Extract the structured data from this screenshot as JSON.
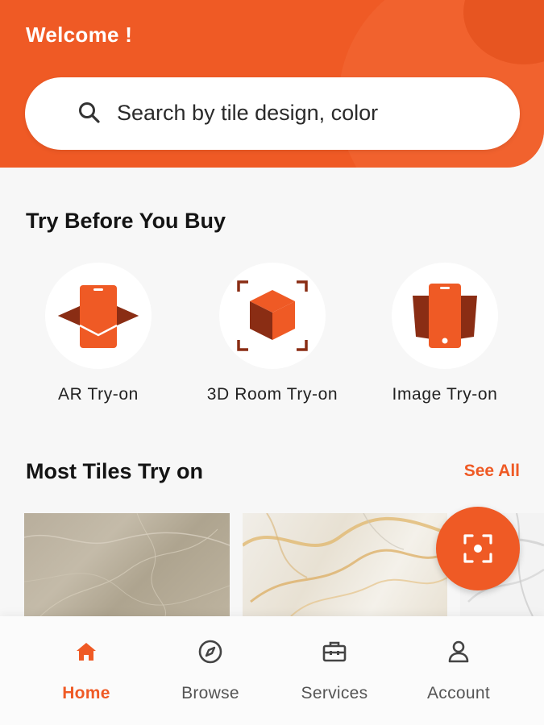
{
  "header": {
    "welcome": "Welcome !"
  },
  "search": {
    "placeholder": "Search by tile design, color"
  },
  "try_before_you_buy": {
    "title": "Try Before You Buy",
    "options": [
      {
        "label": "AR Try-on",
        "icon": "ar-phone-icon"
      },
      {
        "label": "3D Room Try-on",
        "icon": "3d-cube-icon"
      },
      {
        "label": "Image Try-on",
        "icon": "image-phone-icon"
      }
    ]
  },
  "most_tiles": {
    "title": "Most Tiles Try on",
    "see_all": "See All",
    "tiles": [
      {
        "name": "beige-marble-tile"
      },
      {
        "name": "gold-veined-white-marble-tile"
      },
      {
        "name": "white-marble-tile"
      }
    ]
  },
  "fab": {
    "icon": "scan-icon"
  },
  "bottom_nav": {
    "items": [
      {
        "label": "Home",
        "icon": "home-icon",
        "active": true
      },
      {
        "label": "Browse",
        "icon": "compass-icon",
        "active": false
      },
      {
        "label": "Services",
        "icon": "toolbox-icon",
        "active": false
      },
      {
        "label": "Account",
        "icon": "user-icon",
        "active": false
      }
    ]
  },
  "colors": {
    "accent": "#ef5a25",
    "accent_dark": "#8a2d14",
    "background": "#f7f7f7"
  }
}
